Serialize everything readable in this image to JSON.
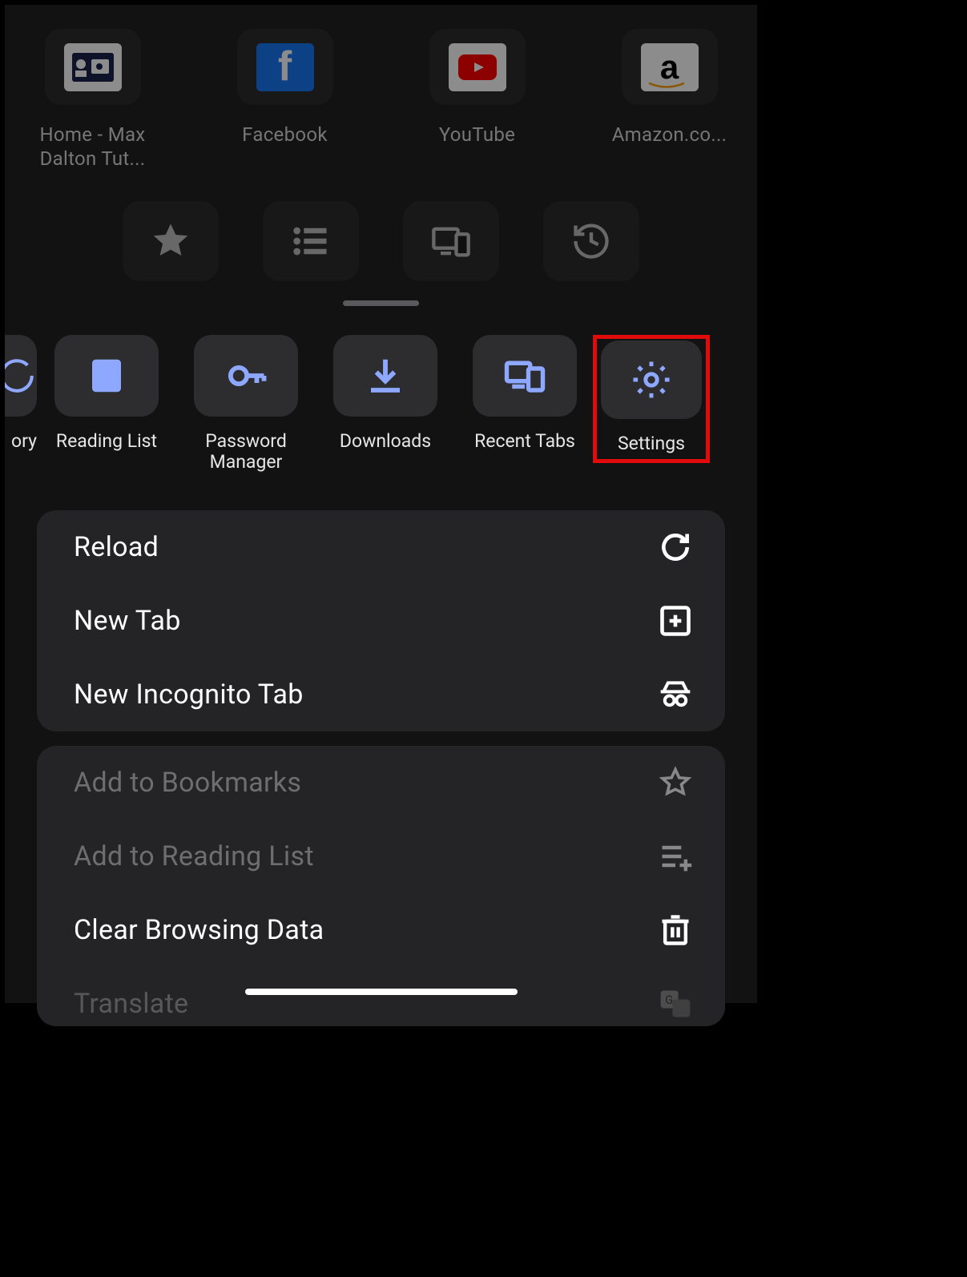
{
  "shortcuts": [
    {
      "label": "Home - Max Dalton Tut...",
      "icon": "site-maxdalton",
      "bg": "#ffffff"
    },
    {
      "label": "Facebook",
      "icon": "site-facebook",
      "bg": "#1877f2"
    },
    {
      "label": "YouTube",
      "icon": "site-youtube",
      "bg": "#ffffff"
    },
    {
      "label": "Amazon.co...",
      "icon": "site-amazon",
      "bg": "#ffffff"
    }
  ],
  "quick_tiles": [
    "bookmarks",
    "reading-list",
    "recent-tabs",
    "history"
  ],
  "carousel": [
    {
      "label": "ory",
      "icon": "history-icon",
      "partial": true
    },
    {
      "label": "Reading List",
      "icon": "reading-list-icon"
    },
    {
      "label": "Password Manager",
      "icon": "key-icon"
    },
    {
      "label": "Downloads",
      "icon": "download-icon"
    },
    {
      "label": "Recent Tabs",
      "icon": "devices-icon"
    },
    {
      "label": "Settings",
      "icon": "gear-icon",
      "highlighted": true
    }
  ],
  "menu_primary": [
    {
      "label": "Reload",
      "icon": "reload-icon"
    },
    {
      "label": "New Tab",
      "icon": "new-tab-icon"
    },
    {
      "label": "New Incognito Tab",
      "icon": "incognito-icon"
    }
  ],
  "menu_secondary": [
    {
      "label": "Add to Bookmarks",
      "icon": "star-outline-icon",
      "enabled": false
    },
    {
      "label": "Add to Reading List",
      "icon": "list-add-icon",
      "enabled": false
    },
    {
      "label": "Clear Browsing Data",
      "icon": "trash-icon",
      "enabled": true
    },
    {
      "label": "Translate",
      "icon": "translate-icon",
      "enabled": false,
      "cut": true
    }
  ],
  "colors": {
    "accent": "#8ea7ff",
    "highlight": "#e20b0b"
  }
}
